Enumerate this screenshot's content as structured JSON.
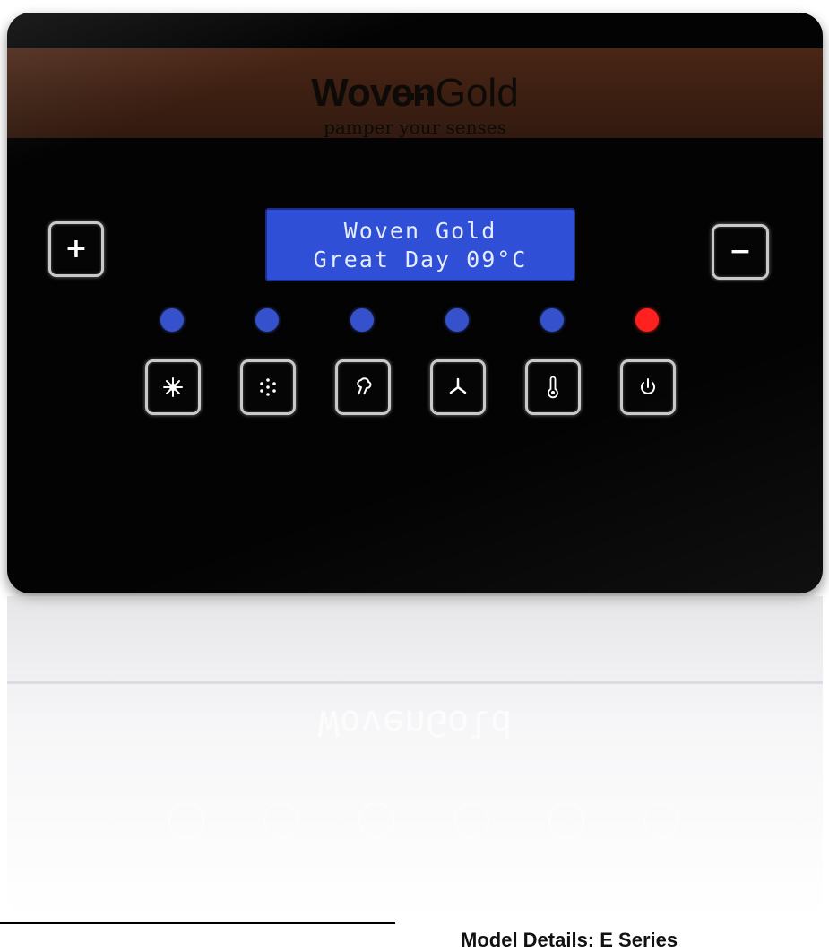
{
  "brand": {
    "name_bold": "Woven",
    "name_light": "Gold",
    "tagline": "pamper your senses"
  },
  "display": {
    "line1": "Woven Gold",
    "line2": "Great Day 09°C"
  },
  "controls": {
    "plus_label": "+",
    "minus_label": "−",
    "buttons": [
      {
        "icon": "light-icon",
        "led": "blue"
      },
      {
        "icon": "dots-icon",
        "led": "blue"
      },
      {
        "icon": "aroma-icon",
        "led": "blue"
      },
      {
        "icon": "fan-icon",
        "led": "blue"
      },
      {
        "icon": "thermometer-icon",
        "led": "blue"
      },
      {
        "icon": "power-icon",
        "led": "red"
      }
    ]
  },
  "reflection_text": "WovenGold",
  "footer": {
    "model": "Model Details: E Series"
  },
  "colors": {
    "panel": "#030303",
    "band": "#3d1f12",
    "lcd": "#2f4fd6",
    "led_blue": "#3552cc",
    "led_red": "#ff2020"
  }
}
